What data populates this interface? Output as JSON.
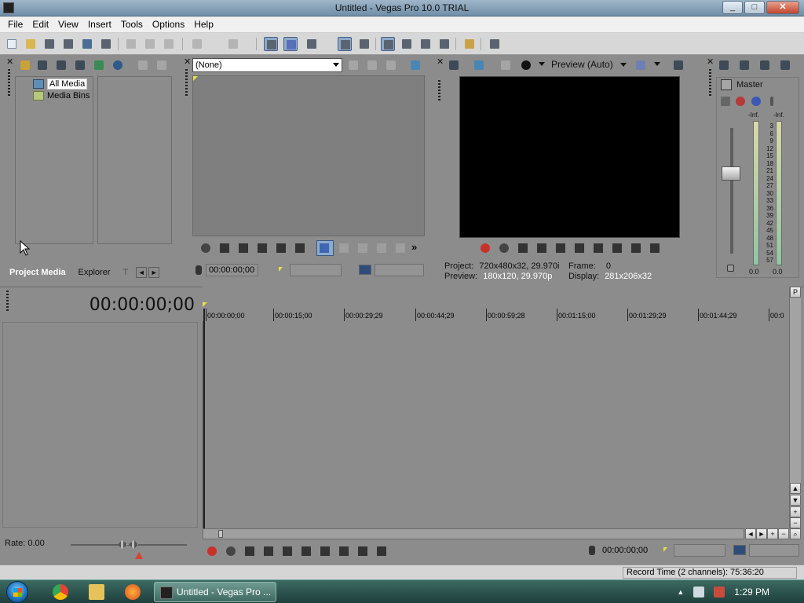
{
  "window": {
    "title": "Untitled - Vegas Pro 10.0 TRIAL",
    "minimize": "_",
    "maximize": "□",
    "close": "✕"
  },
  "menu": [
    "File",
    "Edit",
    "View",
    "Insert",
    "Tools",
    "Options",
    "Help"
  ],
  "project_media": {
    "tree": [
      "All Media",
      "Media Bins"
    ],
    "tabs": [
      "Project Media",
      "Explorer",
      "T"
    ],
    "nav_prev": "◄",
    "nav_next": "►"
  },
  "trimmer": {
    "dropdown_value": "(None)",
    "timecode": "00:00:00;00"
  },
  "preview": {
    "quality": "Preview (Auto)",
    "project_label": "Project:",
    "project_value": "720x480x32, 29.970i",
    "frame_label": "Frame:",
    "frame_value": "0",
    "preview_label": "Preview:",
    "preview_value": "180x120, 29.970p",
    "display_label": "Display:",
    "display_value": "281x206x32"
  },
  "mixer": {
    "title": "Master",
    "peak_left": "-Inf.",
    "peak_right": "-Inf.",
    "scale": [
      "3",
      "6",
      "9",
      "12",
      "15",
      "18",
      "21",
      "24",
      "27",
      "30",
      "33",
      "36",
      "39",
      "42",
      "45",
      "48",
      "51",
      "54",
      "57"
    ],
    "level_left": "0.0",
    "level_right": "0.0"
  },
  "timeline": {
    "timecode": "00:00:00;00",
    "ruler": [
      "00:00:00;00",
      "00:00:15;00",
      "00:00:29;29",
      "00:00:44;29",
      "00:00:59;28",
      "00:01:15;00",
      "00:01:29;29",
      "00:01:44;29",
      "00:0"
    ],
    "rate_label": "Rate: 0.00",
    "transport_timecode": "00:00:00;00"
  },
  "status": {
    "record_time": "Record Time (2 channels): 75:36:20"
  },
  "taskbar": {
    "task_label": "Untitled - Vegas Pro ...",
    "clock": "1:29 PM"
  },
  "colors": {
    "panel": "#8c8c8c",
    "video": "#000000",
    "record": "#c8312a",
    "active_toggle": "#8fa9c9"
  }
}
